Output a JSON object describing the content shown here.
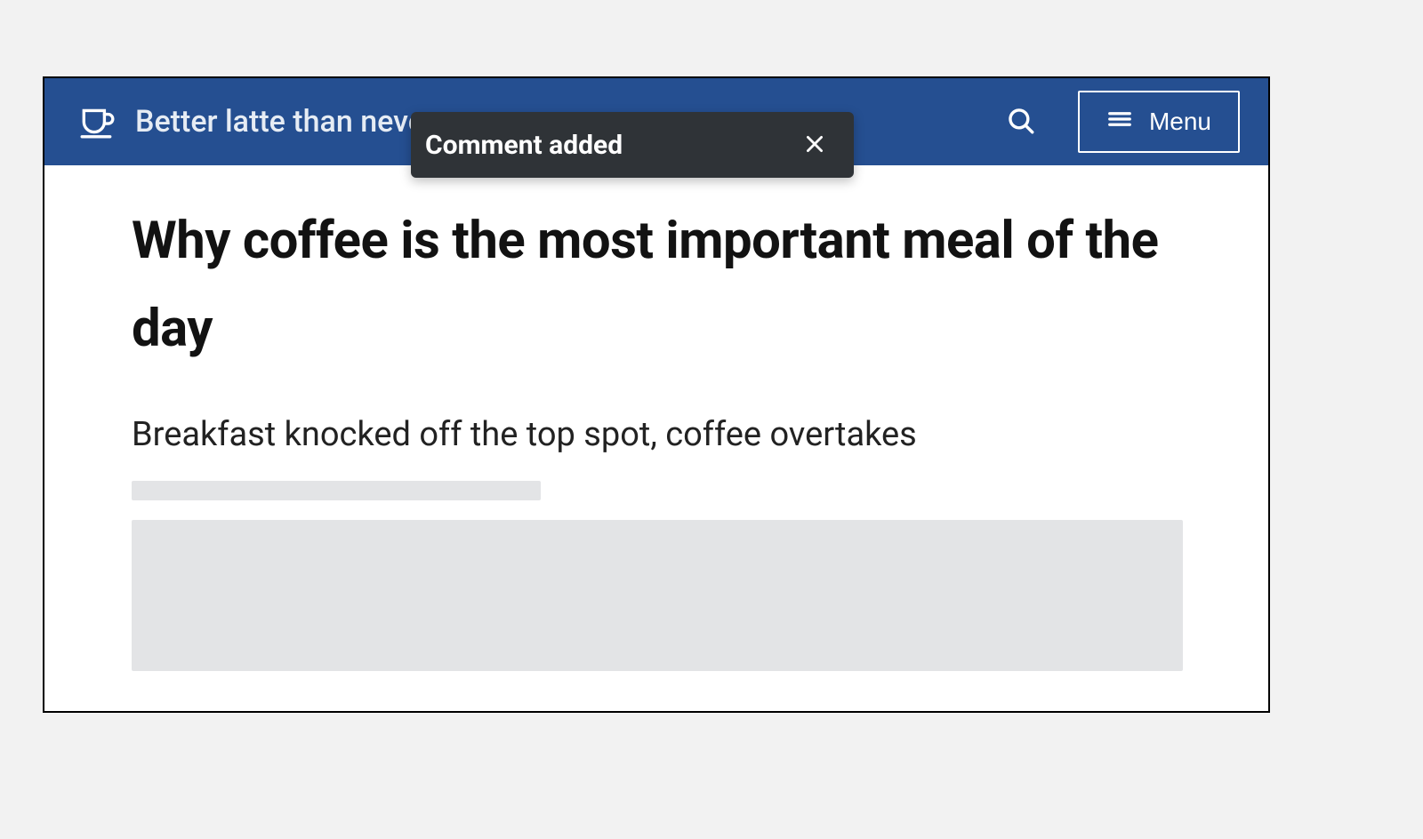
{
  "header": {
    "site_title": "Better latte than never",
    "menu_label": "Menu"
  },
  "article": {
    "title": "Why coffee is the most important meal of the day",
    "subtitle": "Breakfast knocked off the top spot, coffee overtakes"
  },
  "toast": {
    "message": "Comment added"
  }
}
